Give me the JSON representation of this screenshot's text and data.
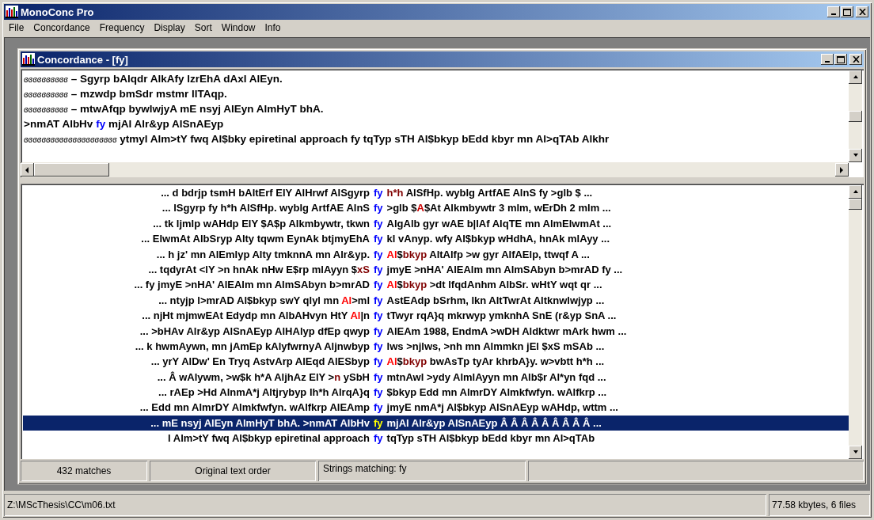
{
  "window": {
    "title": "MonoConc Pro"
  },
  "menu": [
    "File",
    "Concordance",
    "Frequency",
    "Display",
    "Sort",
    "Window",
    "Info"
  ],
  "child_window": {
    "title": "Concordance - [fy]"
  },
  "context_pane": {
    "lines": [
      [
        {
          "text": "ɞɞɞɞɞɞɞɞɞɞ",
          "kind": "glyph"
        },
        {
          "text": " – Sgyrp bAlqdr AlkAfy lzrEhA dAxl AlEyn."
        }
      ],
      [
        {
          "text": "ɞɞɞɞɞɞɞɞɞɞ",
          "kind": "glyph"
        },
        {
          "text": " – mzwdp bmSdr mstmr llTAqp."
        }
      ],
      [
        {
          "text": "ɞɞɞɞɞɞɞɞɞɞ",
          "kind": "glyph"
        },
        {
          "text": " – mtwAfqp bywlwjyA mE nsyj AlEyn AlmHyT bhA."
        }
      ],
      [
        {
          "text": ">nmAT AlbHv "
        },
        {
          "text": "fy",
          "color": "#0000ff"
        },
        {
          "text": " mjAl Alr&yp AlSnAEyp"
        }
      ],
      [
        {
          "text": "ɞɞɞɞɞɞɞɞɞɞɞɞɞɞɞɞɞɞɞɞɞ",
          "kind": "glyph"
        },
        {
          "text": " ytmyl Alm>tY fwq Al$bky epiretinal approach fy tqTyp sTH Al$bkyp bEdd kbyr mn Al>qTAb Alkhr"
        }
      ]
    ]
  },
  "concordance": [
    {
      "selected": false,
      "left": [
        {
          "text": "... d bdrjp tsmH bAltErf ElY AlHrwf AlSgyrp"
        }
      ],
      "key": "fy",
      "right": [
        {
          "text": "h*h",
          "color": "#800000"
        },
        {
          "text": " AlSfHp. wyblg ArtfAE AlnS fy >glb $ ..."
        }
      ]
    },
    {
      "selected": false,
      "left": [
        {
          "text": "... lSgyrp fy h*h AlSfHp. wyblg ArtfAE AlnS"
        }
      ],
      "key": "fy",
      "right": [
        {
          "text": ">glb $"
        },
        {
          "text": "A",
          "color": "#cc0000"
        },
        {
          "text": "$At Alkmbywtr 3 mlm, wErDh 2 mlm ..."
        }
      ]
    },
    {
      "selected": false,
      "left": [
        {
          "text": "... tk ljmlp wAHdp ElY $A$p Alkmbywtr, tkwn"
        }
      ],
      "key": "fy",
      "right": [
        {
          "text": "AlgAlb gyr wAE b|lAf AlqTE mn AlmElwmAt ..."
        }
      ]
    },
    {
      "selected": false,
      "left": [
        {
          "text": "... ElwmAt AlbSryp Alty tqwm EynAk btjmyEhA"
        }
      ],
      "key": "fy",
      "right": [
        {
          "text": "kl vAnyp. wfy Al$bkyp wHdhA, hnAk mlAyy ..."
        }
      ]
    },
    {
      "selected": false,
      "left": [
        {
          "text": "... h jz' mn AlEmlyp Alty tmknnA mn Alr&yp."
        }
      ],
      "key": "fy",
      "right": [
        {
          "text": "Al",
          "color": "#ff0000"
        },
        {
          "text": "$"
        },
        {
          "text": "bkyp",
          "color": "#800000"
        },
        {
          "text": " AltAlfp >w gyr AlfAElp, ttwqf A ..."
        }
      ]
    },
    {
      "selected": false,
      "left": [
        {
          "text": "... tqdyrAt <lY >n hnAk nHw E$rp mlAyyn $"
        },
        {
          "text": "xS",
          "color": "#800000"
        }
      ],
      "key": "fy",
      "right": [
        {
          "text": "jmyE >nHA' AlEAlm mn AlmSAbyn b>mrAD fy ..."
        }
      ]
    },
    {
      "selected": false,
      "left": [
        {
          "text": "... fy jmyE >nHA' AlEAlm mn AlmSAbyn b>mrAD"
        }
      ],
      "key": "fy",
      "right": [
        {
          "text": "Al",
          "color": "#ff0000"
        },
        {
          "text": "$"
        },
        {
          "text": "bkyp",
          "color": "#800000"
        },
        {
          "text": " >dt lfqdAnhm AlbSr. wHtY wqt qr ..."
        }
      ]
    },
    {
      "selected": false,
      "left": [
        {
          "text": "...  ntyjp l>mrAD Al$bkyp swY qlyl mn "
        },
        {
          "text": "Al",
          "color": "#ff0000"
        },
        {
          "text": ">ml"
        }
      ],
      "key": "fy",
      "right": [
        {
          "text": "AstEAdp bSrhm, lkn AltTwrAt Altknwlwjyp ..."
        }
      ]
    },
    {
      "selected": false,
      "left": [
        {
          "text": "... njHt mjmwEAt Edydp mn AlbAHvyn HtY "
        },
        {
          "text": "Al",
          "color": "#ff0000"
        },
        {
          "text": "|n"
        }
      ],
      "key": "fy",
      "right": [
        {
          "text": "tTwyr rqA}q mkrwyp ymknhA SnE (r&yp SnA ..."
        }
      ]
    },
    {
      "selected": false,
      "left": [
        {
          "text": "... >bHAv Alr&yp AlSnAEyp AlHAlyp dfEp qwyp"
        }
      ],
      "key": "fy",
      "right": [
        {
          "text": "AlEAm 1988, EndmA >wDH Aldktwr mArk hwm ..."
        }
      ]
    },
    {
      "selected": false,
      "left": [
        {
          "text": "... k hwmAywn, mn jAmEp kAlyfwrnyA Aljnwbyp"
        }
      ],
      "key": "fy",
      "right": [
        {
          "text": "lws >njlws, >nh mn Almmkn jEl $xS mSAb  ..."
        }
      ]
    },
    {
      "selected": false,
      "left": [
        {
          "text": "... yrY AlDw' En Tryq AstvArp AlEqd AlESbyp"
        }
      ],
      "key": "fy",
      "right": [
        {
          "text": "Al",
          "color": "#ff0000"
        },
        {
          "text": "$"
        },
        {
          "text": "bkyp",
          "color": "#800000"
        },
        {
          "text": " bwAsTp tyAr khrbA}y. w>vbtt h*h ..."
        }
      ]
    },
    {
      "selected": false,
      "left": [
        {
          "text": "...  Â  wAlywm, >w$k h*A AljhAz ElY >"
        },
        {
          "text": "n",
          "color": "#800000"
        },
        {
          "text": " ySbH"
        }
      ],
      "key": "fy",
      "right": [
        {
          "text": "mtnAwl >ydy AlmlAyyn mn Alb$r Al*yn fqd ..."
        }
      ]
    },
    {
      "selected": false,
      "left": [
        {
          "text": "... rAEp >Hd AlnmA*j Altjrybyp lh*h AlrqA}q"
        }
      ],
      "key": "fy",
      "right": [
        {
          "text": "$bkyp Edd mn AlmrDY Almkfwfyn. wAlfkrp  ..."
        }
      ]
    },
    {
      "selected": false,
      "left": [
        {
          "text": "... Edd mn AlmrDY Almkfwfyn. wAlfkrp AlEAmp"
        }
      ],
      "key": "fy",
      "right": [
        {
          "text": "jmyE nmA*j Al$bkyp AlSnAEyp wAHdp, wttm ..."
        }
      ]
    },
    {
      "selected": true,
      "left": [
        {
          "text": "...  mE nsyj AlEyn AlmHyT bhA. >nmAT AlbHv"
        }
      ],
      "key": "fy",
      "right": [
        {
          "text": "mjAl Alr&yp AlSnAEyp Â Â Â Â Â Â Â Â Â ..."
        }
      ]
    },
    {
      "selected": false,
      "left": [
        {
          "text": "l Alm>tY fwq Al$bkyp epiretinal approach"
        }
      ],
      "key": "fy",
      "right": [
        {
          "text": "tqTyp sTH Al$bkyp bEdd kbyr mn Al>qTAb"
        }
      ]
    }
  ],
  "child_status": [
    "432 matches",
    "Original text order",
    "Strings matching: fy"
  ],
  "status_bar": [
    "Z:\\MScThesis\\CC\\m06.txt",
    "77.58 kbytes, 6 files"
  ]
}
